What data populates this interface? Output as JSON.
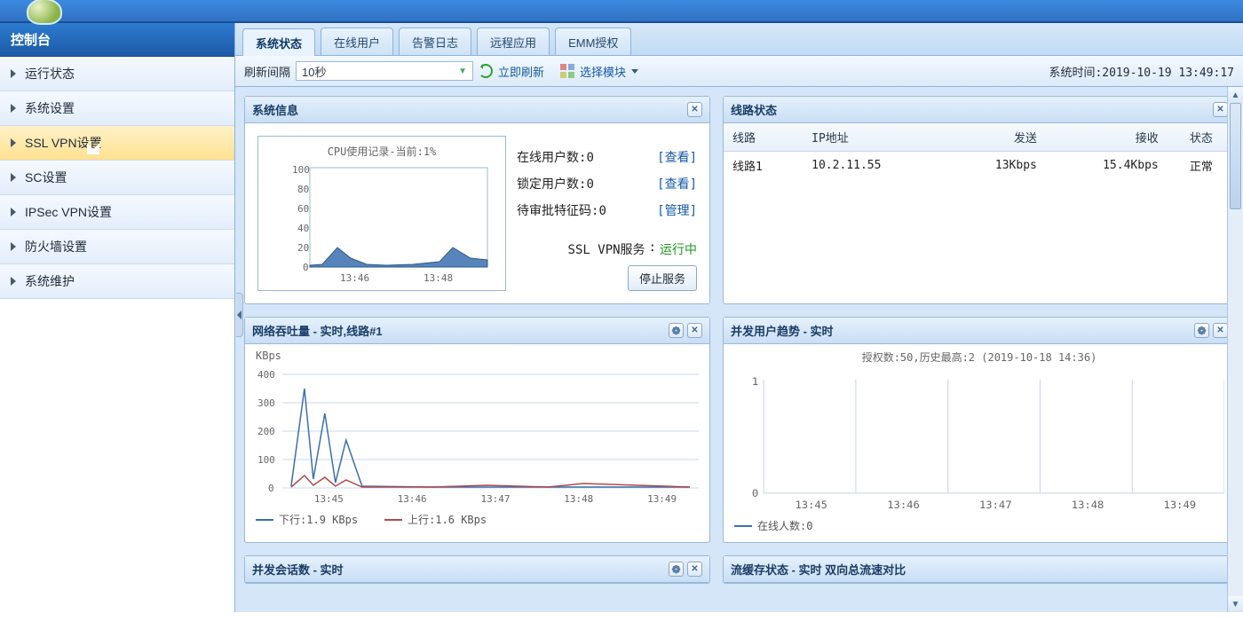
{
  "sidebar": {
    "title": "控制台",
    "items": [
      {
        "label": "运行状态"
      },
      {
        "label": "系统设置"
      },
      {
        "label": "SSL VPN设置",
        "hover": true
      },
      {
        "label": "SC设置"
      },
      {
        "label": "IPSec VPN设置"
      },
      {
        "label": "防火墙设置"
      },
      {
        "label": "系统维护"
      }
    ]
  },
  "tabs": [
    {
      "label": "系统状态",
      "active": true
    },
    {
      "label": "在线用户"
    },
    {
      "label": "告警日志"
    },
    {
      "label": "远程应用"
    },
    {
      "label": "EMM授权"
    }
  ],
  "toolbar": {
    "refresh_label": "刷新间隔",
    "interval": "10秒",
    "refresh_now": "立即刷新",
    "select_modules": "选择模块",
    "system_time_label": "系统时间",
    "system_time": "2019-10-19 13:49:17"
  },
  "panel_sysinfo": {
    "title": "系统信息",
    "cpu_title": "CPU使用记录-当前:1%",
    "online_users_label": "在线用户数",
    "online_users_value": "0",
    "locked_users_label": "锁定用户数",
    "locked_users_value": "0",
    "pending_codes_label": "待审批特征码",
    "pending_codes_value": "0",
    "view_link": "查看",
    "manage_link": "管理",
    "service_label": "SSL VPN服务",
    "service_value": "运行中",
    "stop_btn": "停止服务"
  },
  "panel_linestatus": {
    "title": "线路状态",
    "columns": [
      "线路",
      "IP地址",
      "发送",
      "接收",
      "状态"
    ],
    "rows": [
      {
        "line": "线路1",
        "ip": "10.2.11.55",
        "tx": "13Kbps",
        "rx": "15.4Kbps",
        "status": "正常"
      }
    ]
  },
  "panel_throughput": {
    "title": "网络吞吐量 - 实时,线路#1",
    "unit": "KBps",
    "down_label": "下行",
    "down_value": "1.9 KBps",
    "up_label": "上行",
    "up_value": "1.6 KBps"
  },
  "panel_concurrency": {
    "title": "并发用户趋势 - 实时",
    "subtitle": "授权数:50,历史最高:2 (2019-10-18 14:36)",
    "legend": "在线人数:0"
  },
  "panel_concurrent_sessions": {
    "title": "并发会话数 - 实时"
  },
  "panel_flowcache": {
    "title": "流缓存状态 - 实时 双向总流速对比"
  },
  "chart_data": [
    {
      "id": "cpu_usage",
      "type": "area",
      "title": "CPU使用记录-当前:1%",
      "xlabel": "",
      "ylabel": "",
      "x_ticks": [
        "13:46",
        "13:48"
      ],
      "y_ticks": [
        0,
        20,
        40,
        60,
        80,
        100
      ],
      "ylim": [
        0,
        100
      ],
      "x": [
        "13:45",
        "13:45:30",
        "13:46",
        "13:46:30",
        "13:47",
        "13:47:30",
        "13:48",
        "13:48:30",
        "13:49"
      ],
      "values": [
        2,
        3,
        18,
        8,
        3,
        2,
        4,
        20,
        6
      ]
    },
    {
      "id": "throughput",
      "type": "line",
      "title": "网络吞吐量 - 实时,线路#1",
      "ylabel": "KBps",
      "x_ticks": [
        "13:45",
        "13:46",
        "13:47",
        "13:48",
        "13:49"
      ],
      "y_ticks": [
        0,
        100,
        200,
        300,
        400
      ],
      "ylim": [
        0,
        400
      ],
      "x": [
        "13:44:30",
        "13:44:45",
        "13:45",
        "13:45:15",
        "13:45:30",
        "13:45:45",
        "13:46",
        "13:46:15",
        "13:46:30",
        "13:47",
        "13:47:30",
        "13:48",
        "13:48:30",
        "13:49"
      ],
      "series": [
        {
          "name": "下行",
          "color": "#3a6fae",
          "values": [
            5,
            350,
            30,
            260,
            20,
            160,
            10,
            5,
            5,
            5,
            5,
            5,
            5,
            5
          ]
        },
        {
          "name": "上行",
          "color": "#b04a4a",
          "values": [
            3,
            40,
            10,
            30,
            8,
            25,
            6,
            4,
            4,
            6,
            4,
            10,
            4,
            4
          ]
        }
      ]
    },
    {
      "id": "concurrency",
      "type": "line",
      "title": "授权数:50,历史最高:2 (2019-10-18 14:36)",
      "x_ticks": [
        "13:45",
        "13:46",
        "13:47",
        "13:48",
        "13:49"
      ],
      "y_ticks": [
        0,
        1
      ],
      "ylim": [
        0,
        1
      ],
      "x": [
        "13:45",
        "13:46",
        "13:47",
        "13:48",
        "13:49"
      ],
      "series": [
        {
          "name": "在线人数",
          "color": "#3a6fae",
          "values": [
            0,
            0,
            0,
            0,
            0
          ]
        }
      ]
    }
  ]
}
